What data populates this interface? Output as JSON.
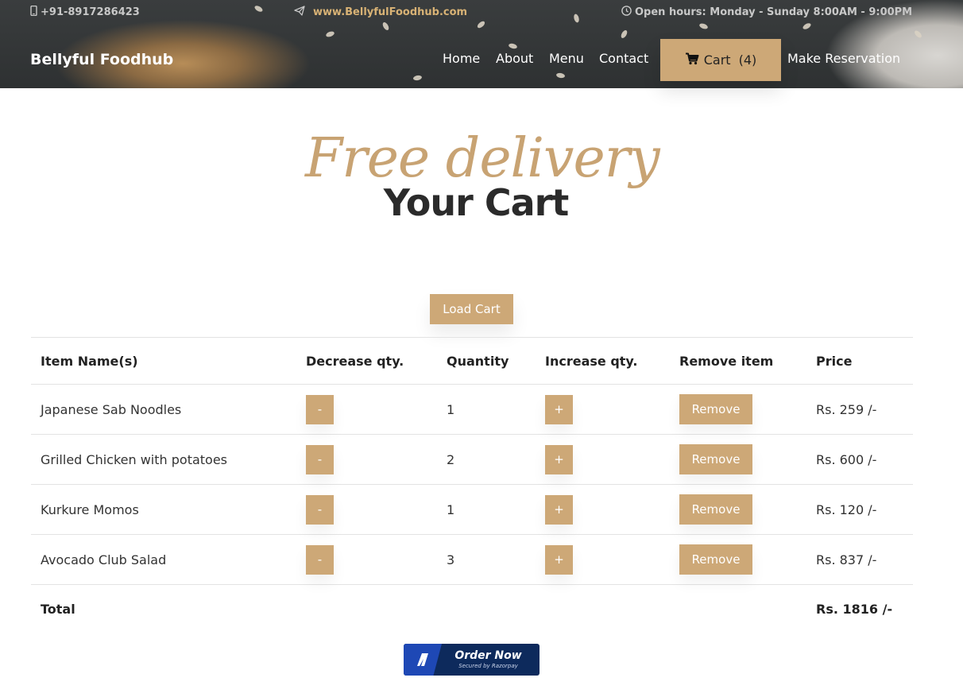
{
  "topbar": {
    "phone": "+91-8917286423",
    "website": "www.BellyfulFoodhub.com",
    "hours": "Open hours: Monday - Sunday 8:00AM - 9:00PM"
  },
  "brand": "Bellyful Foodhub",
  "nav": {
    "home": "Home",
    "about": "About",
    "menu": "Menu",
    "contact": "Contact",
    "cart_label": "Cart",
    "cart_count": "(4)",
    "reservation": "Make Reservation"
  },
  "hero": {
    "script_text": "Free delivery",
    "title": "Your Cart"
  },
  "load_button": "Load Cart",
  "table": {
    "headers": [
      "Item Name(s)",
      "Decrease qty.",
      "Quantity",
      "Increase qty.",
      "Remove item",
      "Price"
    ],
    "rows": [
      {
        "name": "Japanese Sab Noodles",
        "quantity": "1",
        "price": "Rs. 259 /-"
      },
      {
        "name": "Grilled Chicken with potatoes",
        "quantity": "2",
        "price": "Rs. 600 /-"
      },
      {
        "name": "Kurkure Momos",
        "quantity": "1",
        "price": "Rs. 120 /-"
      },
      {
        "name": "Avocado Club Salad",
        "quantity": "3",
        "price": "Rs. 837 /-"
      }
    ],
    "decrease_label": "-",
    "increase_label": "+",
    "remove_label": "Remove",
    "total_label": "Total",
    "total_value": "Rs. 1816 /-"
  },
  "order_button": {
    "label": "Order Now",
    "sub": "Secured by Razorpay"
  },
  "colors": {
    "accent": "#cda877",
    "header_bg": "#2e3132",
    "order_bg": "#0d2a5c"
  }
}
